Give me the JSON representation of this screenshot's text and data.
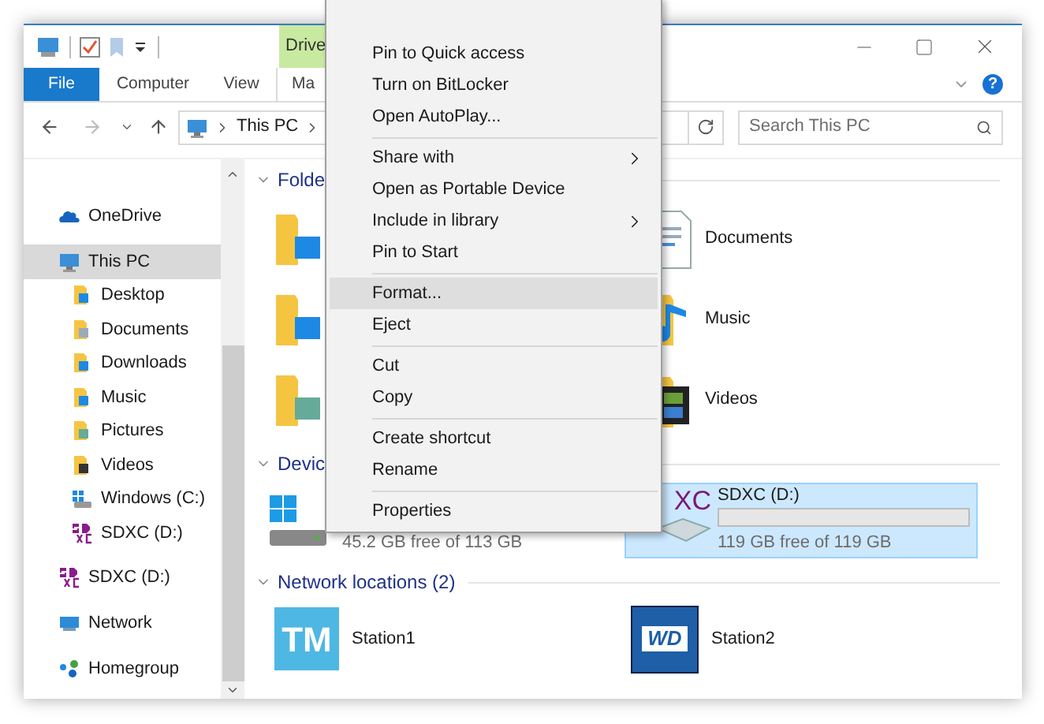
{
  "window": {
    "ribbon_tabs": [
      {
        "label": "File",
        "kind": "file"
      },
      {
        "label": "Computer",
        "kind": "tab"
      },
      {
        "label": "View",
        "kind": "tab"
      },
      {
        "label": "Ma",
        "kind": "contextual"
      }
    ],
    "contextual_group": "Drive",
    "help": "?"
  },
  "address": {
    "path": "This PC"
  },
  "search": {
    "placeholder": "Search This PC"
  },
  "sidebar": {
    "items": [
      {
        "label": "OneDrive",
        "kind": "onedrive",
        "selected": false
      },
      {
        "label": "This PC",
        "kind": "pc",
        "selected": true,
        "children": [
          {
            "label": "Desktop",
            "kind": "desktop",
            "selected": false
          },
          {
            "label": "Documents",
            "kind": "documents",
            "selected": false
          },
          {
            "label": "Downloads",
            "kind": "downloads",
            "selected": false
          },
          {
            "label": "Music",
            "kind": "music",
            "selected": false
          },
          {
            "label": "Pictures",
            "kind": "pictures",
            "selected": false
          },
          {
            "label": "Videos",
            "kind": "videos",
            "selected": false
          },
          {
            "label": "Windows (C:)",
            "kind": "windows",
            "selected": false
          },
          {
            "label": "SDXC (D:)",
            "kind": "sdcard",
            "selected": false
          }
        ]
      },
      {
        "label": "SDXC (D:)",
        "kind": "sdcard",
        "selected": false
      },
      {
        "label": "Network",
        "kind": "network",
        "selected": false
      },
      {
        "label": "Homegroup",
        "kind": "homegroup",
        "selected": false
      }
    ]
  },
  "groups": [
    {
      "title": "Folde",
      "expanded": true,
      "kind": "folders",
      "items": [
        {
          "kind": "desktop"
        },
        {
          "kind": "documents",
          "label": "Documents"
        },
        {
          "kind": "downloads"
        },
        {
          "kind": "music",
          "label": "Music"
        },
        {
          "kind": "pictures"
        },
        {
          "kind": "videos",
          "label": "Videos"
        }
      ]
    },
    {
      "title": "Devic",
      "expanded": true,
      "kind": "devices",
      "items": [
        {
          "kind": "windows",
          "free": "45.2 GB free of 113 GB",
          "selected": false
        },
        {
          "kind": "sdcard",
          "icon_text": "XC",
          "label": "SDXC (D:)",
          "level": 0,
          "free": "119 GB free of 119 GB",
          "selected": true
        }
      ]
    },
    {
      "title": "Network locations (2)",
      "expanded": true,
      "kind": "network",
      "items": [
        {
          "kind": "tm",
          "logo_text": "TM",
          "label": "Station1"
        },
        {
          "kind": "wd",
          "logo_text": "WD",
          "label": "Station2"
        }
      ]
    }
  ],
  "context_menu": {
    "items": [
      {
        "kind": "item",
        "label": "Pin to Quick access",
        "submenu": false,
        "selected": false
      },
      {
        "kind": "item",
        "label": "Turn on BitLocker",
        "submenu": false,
        "selected": false
      },
      {
        "kind": "item",
        "label": "Open AutoPlay...",
        "submenu": false,
        "selected": false
      },
      {
        "kind": "separator"
      },
      {
        "kind": "item",
        "label": "Share with",
        "submenu": true,
        "selected": false
      },
      {
        "kind": "item",
        "label": "Open as Portable Device",
        "submenu": false,
        "selected": false
      },
      {
        "kind": "item",
        "label": "Include in library",
        "submenu": true,
        "selected": false
      },
      {
        "kind": "item",
        "label": "Pin to Start",
        "submenu": false,
        "selected": false
      },
      {
        "kind": "separator"
      },
      {
        "kind": "item",
        "label": "Format...",
        "submenu": false,
        "selected": true
      },
      {
        "kind": "item",
        "label": "Eject",
        "submenu": false,
        "selected": false
      },
      {
        "kind": "separator"
      },
      {
        "kind": "item",
        "label": "Cut",
        "submenu": false,
        "selected": false
      },
      {
        "kind": "item",
        "label": "Copy",
        "submenu": false,
        "selected": false
      },
      {
        "kind": "separator"
      },
      {
        "kind": "item",
        "label": "Create shortcut",
        "submenu": false,
        "selected": false
      },
      {
        "kind": "item",
        "label": "Rename",
        "submenu": false,
        "selected": false
      },
      {
        "kind": "separator"
      },
      {
        "kind": "item",
        "label": "Properties",
        "submenu": false,
        "selected": false
      }
    ]
  }
}
